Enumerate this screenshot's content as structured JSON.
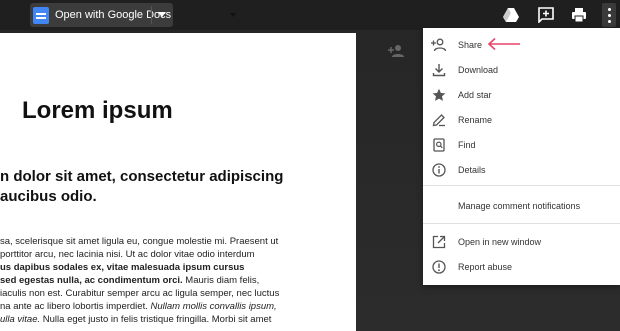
{
  "topbar": {
    "open_with_label": "Open with Google Docs"
  },
  "document": {
    "title": "Lorem ipsum",
    "heading_lines": [
      "n dolor sit amet, consectetur adipiscing",
      "aucibus odio."
    ],
    "para_lines": [
      {
        "text": "sa, scelerisque sit amet ligula eu, congue molestie mi. Praesent ut",
        "style": ""
      },
      {
        "text": "porttitor arcu, nec lacinia nisi. Ut ac dolor vitae odio interdum",
        "style": ""
      },
      {
        "text": "us dapibus sodales ex, vitae malesuada ipsum cursus",
        "style": "b"
      },
      {
        "text": "sed egestas nulla, ac condimentum orci.",
        "style": "b",
        "tail": " Mauris diam felis,"
      },
      {
        "text": "iaculis non est. Curabitur semper arcu ac ligula semper, nec luctus",
        "style": ""
      },
      {
        "text": "na ante ac libero lobortis imperdiet. ",
        "style": "",
        "tail_i": "Nullam mollis convallis ipsum,"
      },
      {
        "text": "ulla vitae.",
        "style": "i",
        "tail": " Nulla eget justo in felis tristique fringilla. Morbi sit amet"
      }
    ]
  },
  "menu": {
    "items": [
      {
        "label": "Share",
        "icon": "person-add-icon"
      },
      {
        "label": "Download",
        "icon": "download-icon"
      },
      {
        "label": "Add star",
        "icon": "star-icon"
      },
      {
        "label": "Rename",
        "icon": "pencil-icon"
      },
      {
        "label": "Find",
        "icon": "find-icon"
      },
      {
        "label": "Details",
        "icon": "info-icon"
      },
      {
        "label": "Manage comment notifications",
        "icon": ""
      },
      {
        "label": "Open in new window",
        "icon": "open-new-window-icon"
      },
      {
        "label": "Report abuse",
        "icon": "report-icon"
      }
    ]
  },
  "colors": {
    "annotation_arrow": "#e8456a",
    "docs_blue": "#4285f4"
  }
}
